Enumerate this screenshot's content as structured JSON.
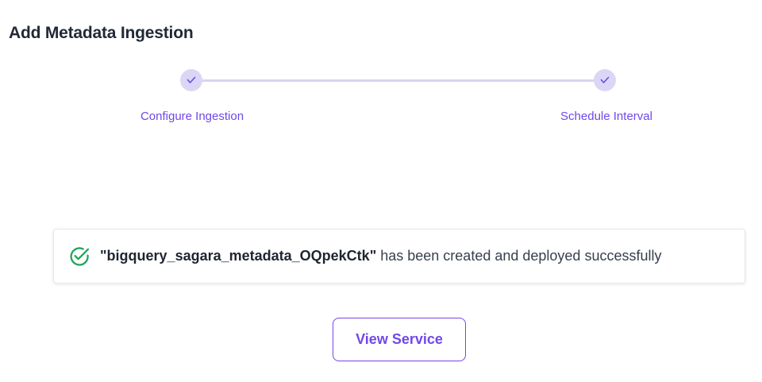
{
  "page": {
    "title": "Add Metadata Ingestion"
  },
  "stepper": {
    "steps": [
      {
        "label": "Configure Ingestion",
        "status": "completed",
        "icon": "check-icon"
      },
      {
        "label": "Schedule Interval",
        "status": "completed",
        "icon": "check-icon"
      }
    ]
  },
  "success": {
    "icon": "check-circle-icon",
    "quote_open": "\"",
    "pipeline_name": "bigquery_sagara_metadata_OQpekCtk",
    "quote_close": "\"",
    "message": " has been created and deployed successfully"
  },
  "actions": {
    "view_service_label": "View Service"
  },
  "colors": {
    "accent": "#7147e8",
    "success": "#22a55a",
    "step_dot": "#dcd6f6",
    "step_line": "#d8d3ee"
  }
}
